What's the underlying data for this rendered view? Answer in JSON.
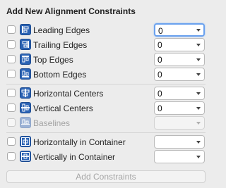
{
  "panel": {
    "title": "Add New Alignment Constraints",
    "add_button_label": "Add Constraints"
  },
  "rows": [
    {
      "label": "Leading Edges",
      "value": "0",
      "enabled": true,
      "focused": true,
      "icon": "leading-edges-icon"
    },
    {
      "label": "Trailing Edges",
      "value": "0",
      "enabled": true,
      "icon": "trailing-edges-icon"
    },
    {
      "label": "Top Edges",
      "value": "0",
      "enabled": true,
      "icon": "top-edges-icon"
    },
    {
      "label": "Bottom Edges",
      "value": "0",
      "enabled": true,
      "icon": "bottom-edges-icon"
    },
    {
      "label": "Horizontal Centers",
      "value": "0",
      "enabled": true,
      "icon": "horizontal-centers-icon"
    },
    {
      "label": "Vertical Centers",
      "value": "0",
      "enabled": true,
      "icon": "vertical-centers-icon"
    },
    {
      "label": "Baselines",
      "value": "",
      "enabled": false,
      "icon": "baselines-icon"
    },
    {
      "label": "Horizontally in Container",
      "value": "",
      "enabled": true,
      "icon": "horizontally-in-container-icon"
    },
    {
      "label": "Vertically in Container",
      "value": "",
      "enabled": true,
      "icon": "vertically-in-container-icon"
    }
  ],
  "colors": {
    "icon_blue": "#2b63b4",
    "focus_ring": "#6aa1ee",
    "disabled_text": "#a3a3a3"
  }
}
